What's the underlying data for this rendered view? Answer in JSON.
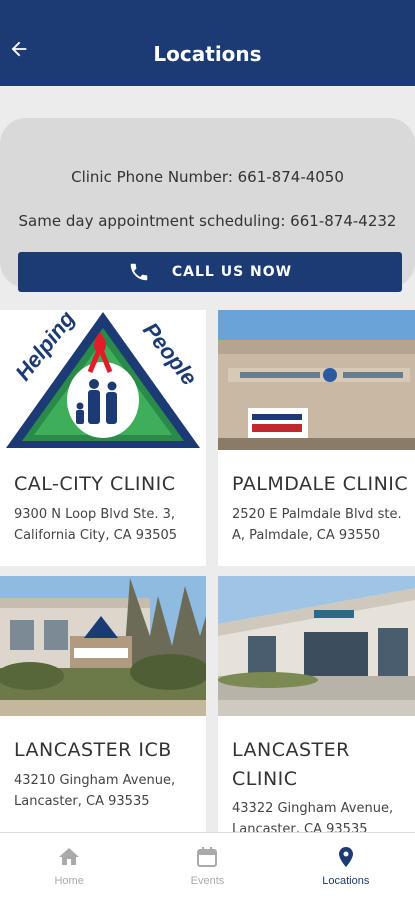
{
  "header": {
    "title": "Locations"
  },
  "info": {
    "phone_line": "Clinic Phone Number:  661-874-4050",
    "sched_line": "Same day appointment scheduling: 661-874-4232",
    "call_label": "CALL US NOW"
  },
  "locations": [
    {
      "name": "CAL-CITY CLINIC",
      "address": "9300 N Loop Blvd Ste. 3, California City, CA 93505",
      "logo_text_left": "Helping",
      "logo_text_right": "People"
    },
    {
      "name": "PALMDALE CLINIC",
      "address": "2520 E Palmdale Blvd ste. A, Palmdale, CA 93550"
    },
    {
      "name": "LANCASTER ICB",
      "address": "43210 Gingham Avenue, Lancaster, CA 93535"
    },
    {
      "name": "LANCASTER CLINIC",
      "address": "43322 Gingham Avenue, Lancaster, CA 93535"
    }
  ],
  "nav": [
    {
      "label": "Home",
      "icon": "home-icon"
    },
    {
      "label": "Events",
      "icon": "calendar-icon"
    },
    {
      "label": "Locations",
      "icon": "location-pin-icon",
      "active": true
    }
  ],
  "colors": {
    "primary": "#1c3b74",
    "background": "#ececec"
  }
}
